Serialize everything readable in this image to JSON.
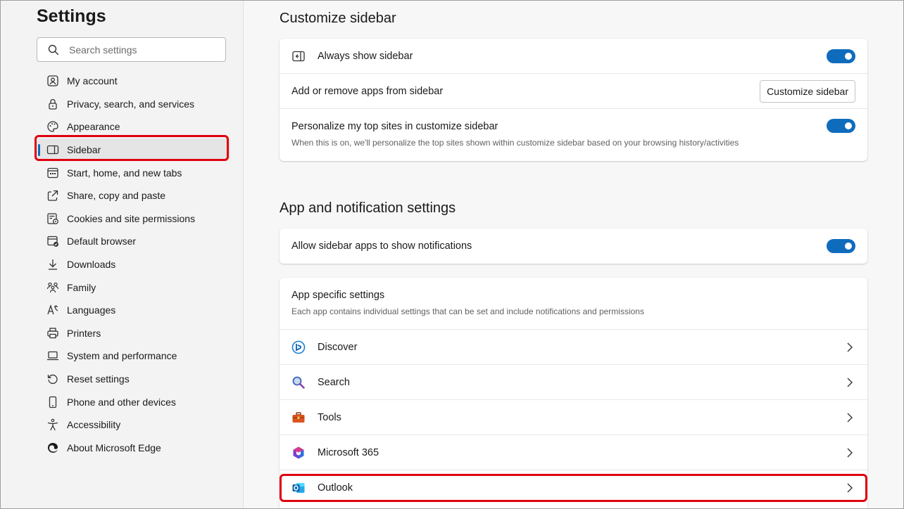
{
  "nav": {
    "title": "Settings",
    "search_placeholder": "Search settings",
    "items": [
      {
        "label": "My account",
        "icon": "user-account-icon"
      },
      {
        "label": "Privacy, search, and services",
        "icon": "lock-icon"
      },
      {
        "label": "Appearance",
        "icon": "palette-icon"
      },
      {
        "label": "Sidebar",
        "icon": "sidebar-icon"
      },
      {
        "label": "Start, home, and new tabs",
        "icon": "home-tabs-icon"
      },
      {
        "label": "Share, copy and paste",
        "icon": "share-icon"
      },
      {
        "label": "Cookies and site permissions",
        "icon": "cookies-icon"
      },
      {
        "label": "Default browser",
        "icon": "default-browser-icon"
      },
      {
        "label": "Downloads",
        "icon": "download-icon"
      },
      {
        "label": "Family",
        "icon": "family-icon"
      },
      {
        "label": "Languages",
        "icon": "languages-icon"
      },
      {
        "label": "Printers",
        "icon": "printer-icon"
      },
      {
        "label": "System and performance",
        "icon": "laptop-icon"
      },
      {
        "label": "Reset settings",
        "icon": "reset-icon"
      },
      {
        "label": "Phone and other devices",
        "icon": "phone-icon"
      },
      {
        "label": "Accessibility",
        "icon": "accessibility-icon"
      },
      {
        "label": "About Microsoft Edge",
        "icon": "edge-logo-icon"
      }
    ]
  },
  "customize": {
    "title": "Customize sidebar",
    "always_show": "Always show sidebar",
    "add_remove": "Add or remove apps from sidebar",
    "customize_button": "Customize sidebar",
    "personalize": "Personalize my top sites in customize sidebar",
    "personalize_desc": "When this is on, we'll personalize the top sites shown within customize sidebar based on your browsing history/activities"
  },
  "apps": {
    "title": "App and notification settings",
    "allow_notifications": "Allow sidebar apps to show notifications",
    "specific_title": "App specific settings",
    "specific_desc": "Each app contains individual settings that can be set and include notifications and permissions",
    "list": [
      {
        "label": "Discover",
        "icon": "discover-icon"
      },
      {
        "label": "Search",
        "icon": "search-app-icon"
      },
      {
        "label": "Tools",
        "icon": "toolbox-icon"
      },
      {
        "label": "Microsoft 365",
        "icon": "microsoft-365-icon"
      },
      {
        "label": "Outlook",
        "icon": "outlook-icon"
      }
    ]
  },
  "colors": {
    "accent": "#0f6cbd",
    "highlight": "#e0000f"
  }
}
